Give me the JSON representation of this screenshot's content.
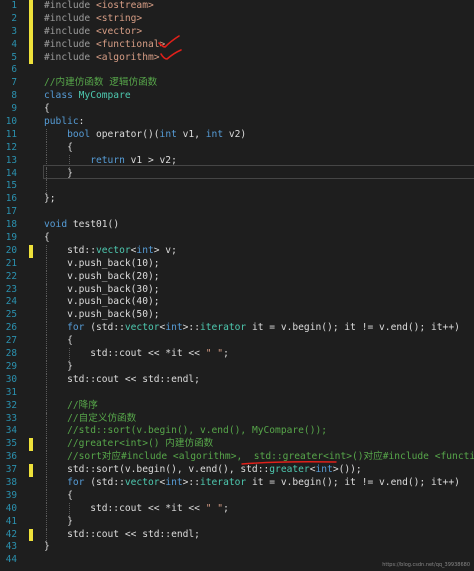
{
  "editor": {
    "lines": [
      {
        "n": "1",
        "mark": "yellow",
        "guides": [],
        "segs": [
          [
            "pp",
            "#include "
          ],
          [
            "str",
            "<iostream>"
          ]
        ]
      },
      {
        "n": "2",
        "mark": "yellow",
        "guides": [],
        "segs": [
          [
            "pp",
            "#include "
          ],
          [
            "str",
            "<string>"
          ]
        ]
      },
      {
        "n": "3",
        "mark": "yellow",
        "guides": [],
        "segs": [
          [
            "pp",
            "#include "
          ],
          [
            "str",
            "<vector>"
          ]
        ]
      },
      {
        "n": "4",
        "mark": "yellow",
        "guides": [],
        "segs": [
          [
            "pp",
            "#include "
          ],
          [
            "str",
            "<functional>"
          ]
        ]
      },
      {
        "n": "5",
        "mark": "yellow",
        "guides": [],
        "segs": [
          [
            "pp",
            "#include "
          ],
          [
            "str",
            "<algorithm>"
          ]
        ]
      },
      {
        "n": "6",
        "mark": "",
        "guides": [],
        "segs": []
      },
      {
        "n": "7",
        "mark": "",
        "guides": [],
        "segs": [
          [
            "cm",
            "//内建仿函数 逻辑仿函数"
          ]
        ]
      },
      {
        "n": "8",
        "mark": "",
        "guides": [],
        "segs": [
          [
            "kw",
            "class "
          ],
          [
            "ty",
            "MyCompare"
          ]
        ]
      },
      {
        "n": "9",
        "mark": "",
        "guides": [],
        "segs": [
          [
            "tx",
            "{"
          ]
        ]
      },
      {
        "n": "10",
        "mark": "",
        "guides": [],
        "segs": [
          [
            "kw",
            "public"
          ],
          [
            "tx",
            ":"
          ]
        ]
      },
      {
        "n": "11",
        "mark": "",
        "guides": [
          0
        ],
        "segs": [
          [
            "tx",
            "    "
          ],
          [
            "kw",
            "bool "
          ],
          [
            "tx",
            "operator()("
          ],
          [
            "kw",
            "int "
          ],
          [
            "tx",
            "v1, "
          ],
          [
            "kw",
            "int "
          ],
          [
            "tx",
            "v2)"
          ]
        ]
      },
      {
        "n": "12",
        "mark": "",
        "guides": [
          0
        ],
        "segs": [
          [
            "tx",
            "    {"
          ]
        ]
      },
      {
        "n": "13",
        "mark": "",
        "guides": [
          0,
          1
        ],
        "segs": [
          [
            "tx",
            "        "
          ],
          [
            "kw",
            "return "
          ],
          [
            "tx",
            "v1 > v2;"
          ]
        ]
      },
      {
        "n": "14",
        "mark": "",
        "guides": [
          0
        ],
        "segs": [
          [
            "tx",
            "    }"
          ]
        ]
      },
      {
        "n": "15",
        "mark": "",
        "guides": [
          0
        ],
        "segs": []
      },
      {
        "n": "16",
        "mark": "",
        "guides": [],
        "segs": [
          [
            "tx",
            "};"
          ]
        ]
      },
      {
        "n": "17",
        "mark": "",
        "guides": [],
        "segs": []
      },
      {
        "n": "18",
        "mark": "",
        "guides": [],
        "segs": [
          [
            "kw",
            "void "
          ],
          [
            "tx",
            "test01()"
          ]
        ]
      },
      {
        "n": "19",
        "mark": "",
        "guides": [],
        "segs": [
          [
            "tx",
            "{"
          ]
        ]
      },
      {
        "n": "20",
        "mark": "yellow",
        "guides": [
          0
        ],
        "segs": [
          [
            "tx",
            "    std::"
          ],
          [
            "ty",
            "vector"
          ],
          [
            "tx",
            "<"
          ],
          [
            "kw",
            "int"
          ],
          [
            "tx",
            "> v;"
          ]
        ]
      },
      {
        "n": "21",
        "mark": "",
        "guides": [
          0
        ],
        "segs": [
          [
            "tx",
            "    v.push_back(10);"
          ]
        ]
      },
      {
        "n": "22",
        "mark": "",
        "guides": [
          0
        ],
        "segs": [
          [
            "tx",
            "    v.push_back(20);"
          ]
        ]
      },
      {
        "n": "23",
        "mark": "",
        "guides": [
          0
        ],
        "segs": [
          [
            "tx",
            "    v.push_back(30);"
          ]
        ]
      },
      {
        "n": "24",
        "mark": "",
        "guides": [
          0
        ],
        "segs": [
          [
            "tx",
            "    v.push_back(40);"
          ]
        ]
      },
      {
        "n": "25",
        "mark": "",
        "guides": [
          0
        ],
        "segs": [
          [
            "tx",
            "    v.push_back(50);"
          ]
        ]
      },
      {
        "n": "26",
        "mark": "",
        "guides": [
          0
        ],
        "segs": [
          [
            "tx",
            "    "
          ],
          [
            "kw",
            "for "
          ],
          [
            "tx",
            "(std::"
          ],
          [
            "ty",
            "vector"
          ],
          [
            "tx",
            "<"
          ],
          [
            "kw",
            "int"
          ],
          [
            "tx",
            ">::"
          ],
          [
            "ty",
            "iterator "
          ],
          [
            "tx",
            "it = v.begin(); it != v.end(); it++)"
          ]
        ]
      },
      {
        "n": "27",
        "mark": "",
        "guides": [
          0
        ],
        "segs": [
          [
            "tx",
            "    {"
          ]
        ]
      },
      {
        "n": "28",
        "mark": "",
        "guides": [
          0,
          1
        ],
        "segs": [
          [
            "tx",
            "        std::cout << *it << "
          ],
          [
            "str",
            "\" \""
          ],
          [
            "tx",
            ";"
          ]
        ]
      },
      {
        "n": "29",
        "mark": "",
        "guides": [
          0
        ],
        "segs": [
          [
            "tx",
            "    }"
          ]
        ]
      },
      {
        "n": "30",
        "mark": "",
        "guides": [
          0
        ],
        "segs": [
          [
            "tx",
            "    std::cout << std::endl;"
          ]
        ]
      },
      {
        "n": "31",
        "mark": "",
        "guides": [
          0
        ],
        "segs": []
      },
      {
        "n": "32",
        "mark": "",
        "guides": [
          0
        ],
        "segs": [
          [
            "tx",
            "    "
          ],
          [
            "cm",
            "//降序"
          ]
        ]
      },
      {
        "n": "33",
        "mark": "",
        "guides": [
          0
        ],
        "segs": [
          [
            "tx",
            "    "
          ],
          [
            "cm",
            "//自定义仿函数"
          ]
        ]
      },
      {
        "n": "34",
        "mark": "",
        "guides": [
          0
        ],
        "segs": [
          [
            "tx",
            "    "
          ],
          [
            "cm",
            "//std::sort(v.begin(), v.end(), MyCompare());"
          ]
        ]
      },
      {
        "n": "35",
        "mark": "yellow",
        "guides": [
          0
        ],
        "segs": [
          [
            "tx",
            "    "
          ],
          [
            "cm",
            "//greater<int>() 内建仿函数"
          ]
        ]
      },
      {
        "n": "36",
        "mark": "",
        "guides": [
          0
        ],
        "segs": [
          [
            "tx",
            "    "
          ],
          [
            "cm",
            "//sort对应#include <algorithm>,  std::greater<int>()对应#include <functional>"
          ]
        ]
      },
      {
        "n": "37",
        "mark": "yellow",
        "guides": [
          0
        ],
        "segs": [
          [
            "tx",
            "    std::sort(v.begin(), v.end(), std::"
          ],
          [
            "ty",
            "greater"
          ],
          [
            "tx",
            "<"
          ],
          [
            "kw",
            "int"
          ],
          [
            "tx",
            ">());"
          ]
        ]
      },
      {
        "n": "38",
        "mark": "",
        "guides": [
          0
        ],
        "segs": [
          [
            "tx",
            "    "
          ],
          [
            "kw",
            "for "
          ],
          [
            "tx",
            "(std::"
          ],
          [
            "ty",
            "vector"
          ],
          [
            "tx",
            "<"
          ],
          [
            "kw",
            "int"
          ],
          [
            "tx",
            ">::"
          ],
          [
            "ty",
            "iterator "
          ],
          [
            "tx",
            "it = v.begin(); it != v.end(); it++)"
          ]
        ]
      },
      {
        "n": "39",
        "mark": "",
        "guides": [
          0
        ],
        "segs": [
          [
            "tx",
            "    {"
          ]
        ]
      },
      {
        "n": "40",
        "mark": "",
        "guides": [
          0,
          1
        ],
        "segs": [
          [
            "tx",
            "        std::cout << *it << "
          ],
          [
            "str",
            "\" \""
          ],
          [
            "tx",
            ";"
          ]
        ]
      },
      {
        "n": "41",
        "mark": "",
        "guides": [
          0
        ],
        "segs": [
          [
            "tx",
            "    }"
          ]
        ]
      },
      {
        "n": "42",
        "mark": "yellow",
        "guides": [
          0
        ],
        "segs": [
          [
            "tx",
            "    std::cout << std::endl;"
          ]
        ]
      },
      {
        "n": "43",
        "mark": "",
        "guides": [],
        "segs": [
          [
            "tx",
            "}"
          ]
        ]
      },
      {
        "n": "44",
        "mark": "",
        "guides": [],
        "segs": []
      }
    ],
    "watermark": "https://blog.csdn.net/qq_39938680"
  },
  "colors": {
    "background": "#1e1e1e",
    "line_number": "#2b91af",
    "keyword": "#569cd6",
    "type": "#4ec9b0",
    "comment": "#57a64a",
    "string": "#d69d85",
    "preprocessor": "#9b9b9b",
    "text": "#dcdcdc",
    "annotation_ink": "#e0201a"
  },
  "annotations": [
    {
      "name": "checkmark-functional-icon",
      "line": "4"
    },
    {
      "name": "checkmark-algorithm-icon",
      "line": "5"
    },
    {
      "name": "underline-greater-int",
      "line": "37"
    }
  ]
}
